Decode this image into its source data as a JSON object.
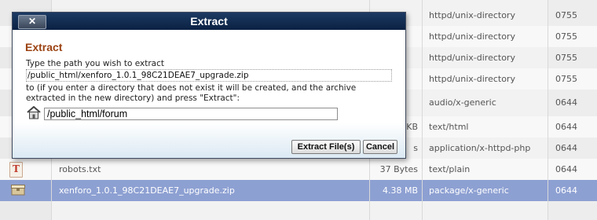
{
  "rows": [
    {
      "name": "",
      "size": "",
      "type": "httpd/unix-directory",
      "perms": "0755"
    },
    {
      "name": "",
      "size": "",
      "type": "httpd/unix-directory",
      "perms": "0755"
    },
    {
      "name": "",
      "size": "",
      "type": "httpd/unix-directory",
      "perms": "0755"
    },
    {
      "name": "",
      "size": "",
      "type": "httpd/unix-directory",
      "perms": "0755"
    },
    {
      "name": "",
      "size": "",
      "type": "audio/x-generic",
      "perms": "0644"
    },
    {
      "name": "",
      "size": "KB",
      "type": "text/html",
      "perms": "0644"
    },
    {
      "name": "",
      "size": "s",
      "type": "application/x-httpd-php",
      "perms": "0644"
    },
    {
      "name": "robots.txt",
      "size": "37 Bytes",
      "type": "text/plain",
      "perms": "0644"
    },
    {
      "name": "xenforo_1.0.1_98C21DEAE7_upgrade.zip",
      "size": "4.38 MB",
      "type": "package/x-generic",
      "perms": "0644"
    }
  ],
  "dialog": {
    "title": "Extract",
    "close_label": "✕",
    "heading": "Extract",
    "prompt": "Type the path you wish to extract",
    "archive_path": "/public_html/xenforo_1.0.1_98C21DEAE7_upgrade.zip",
    "info": "to (if you enter a directory that does not exist it will be created, and the archive extracted in the new directory) and press \"Extract\":",
    "destination_value": "/public_html/forum",
    "extract_button": "Extract File(s)",
    "cancel_button": "Cancel"
  },
  "icons": [
    "folder-icon",
    "text-file-icon",
    "archive-icon",
    "home-icon",
    "close-icon"
  ],
  "colors": {
    "title_bar": "#0b2142",
    "heading": "#9b4212",
    "selected_row": "#8da0d2"
  }
}
